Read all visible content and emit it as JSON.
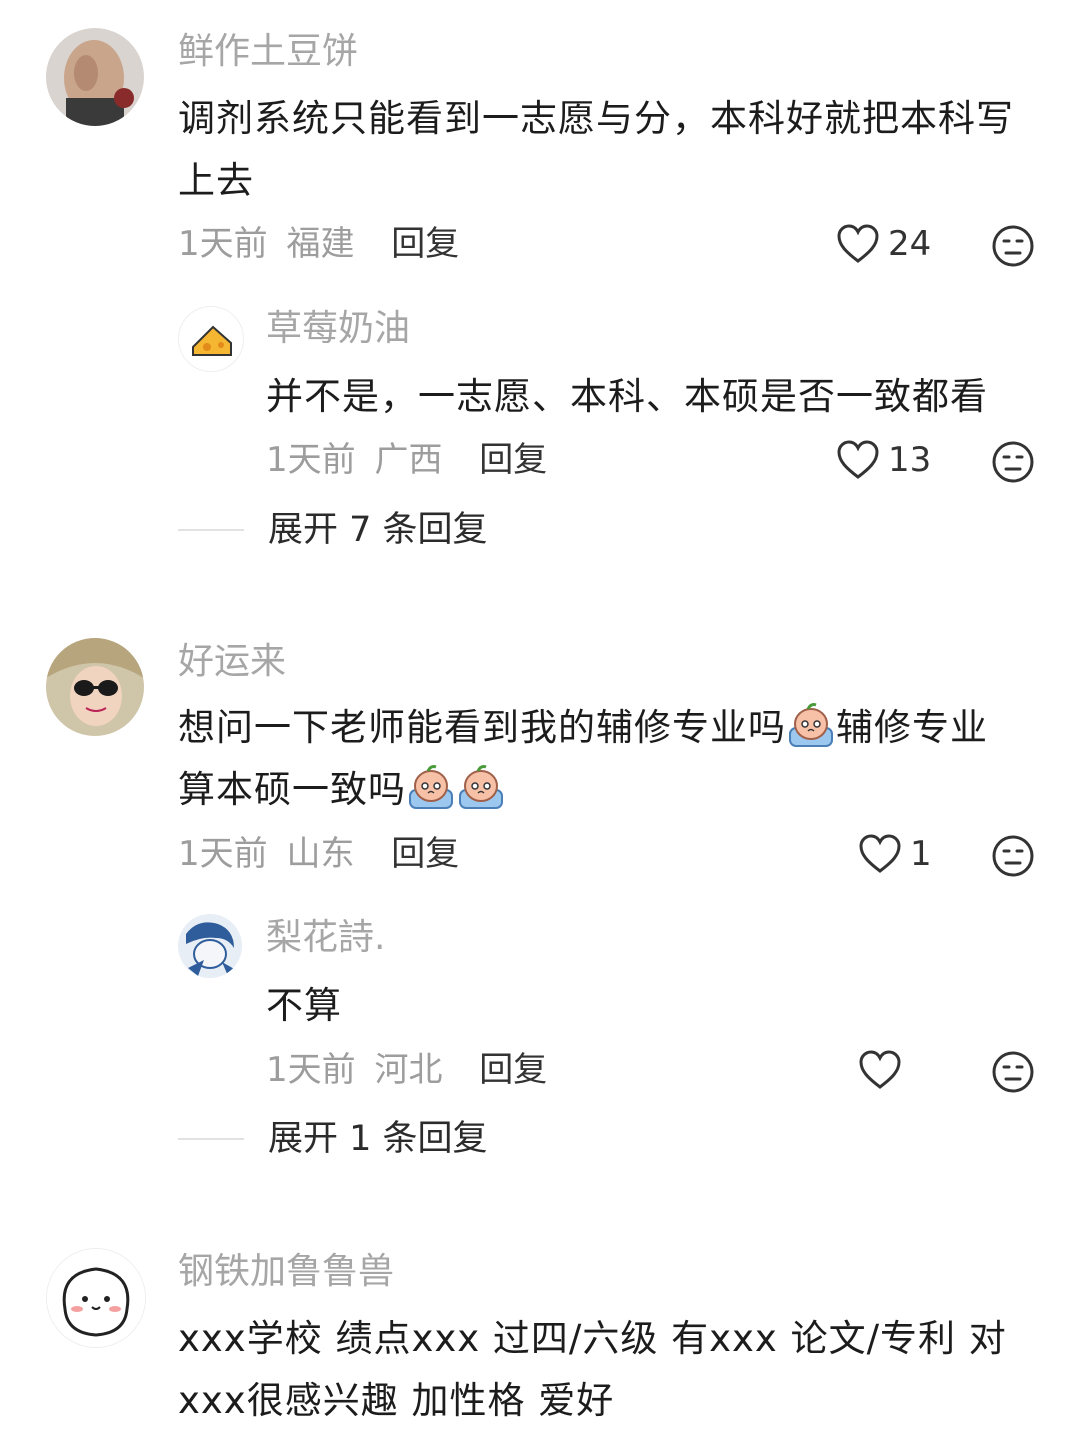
{
  "comments": [
    {
      "username": "鲜作土豆饼",
      "text": "调剂系统只能看到一志愿与分，本科好就把本科写上去",
      "time": "1天前",
      "location": "福建",
      "reply_label": "回复",
      "likes": "24",
      "avatar_icon": "person-photo-avatar",
      "replies": [
        {
          "username": "草莓奶油",
          "text": "并不是，一志愿、本科、本硕是否一致都看",
          "time": "1天前",
          "location": "广西",
          "reply_label": "回复",
          "likes": "13",
          "avatar_icon": "cheese-avatar"
        }
      ],
      "expand_label": "展开 7 条回复"
    },
    {
      "username": "好运来",
      "text_part1": "想问一下老师能看到我的辅修专业吗",
      "text_part2": "辅修专业",
      "text_part3": "算本硕一致吗",
      "time": "1天前",
      "location": "山东",
      "reply_label": "回复",
      "likes": "1",
      "avatar_icon": "sunglasses-girl-avatar",
      "emoji_icon": "crying-peach-emoji",
      "replies": [
        {
          "username": "梨花詩.",
          "text": "不算",
          "time": "1天前",
          "location": "河北",
          "reply_label": "回复",
          "likes": "",
          "avatar_icon": "anime-sketch-avatar"
        }
      ],
      "expand_label": "展开 1 条回复"
    },
    {
      "username": "钢铁加鲁鲁兽",
      "text_line1": "xxx学校 绩点xxx 过四/六级 有xxx 论文/专利 对",
      "text_line2": "xxx很感兴趣 加性格 爱好",
      "avatar_icon": "blob-face-avatar"
    }
  ],
  "icons": {
    "like": "heart-outline-icon",
    "dislike": "neutral-face-icon"
  }
}
